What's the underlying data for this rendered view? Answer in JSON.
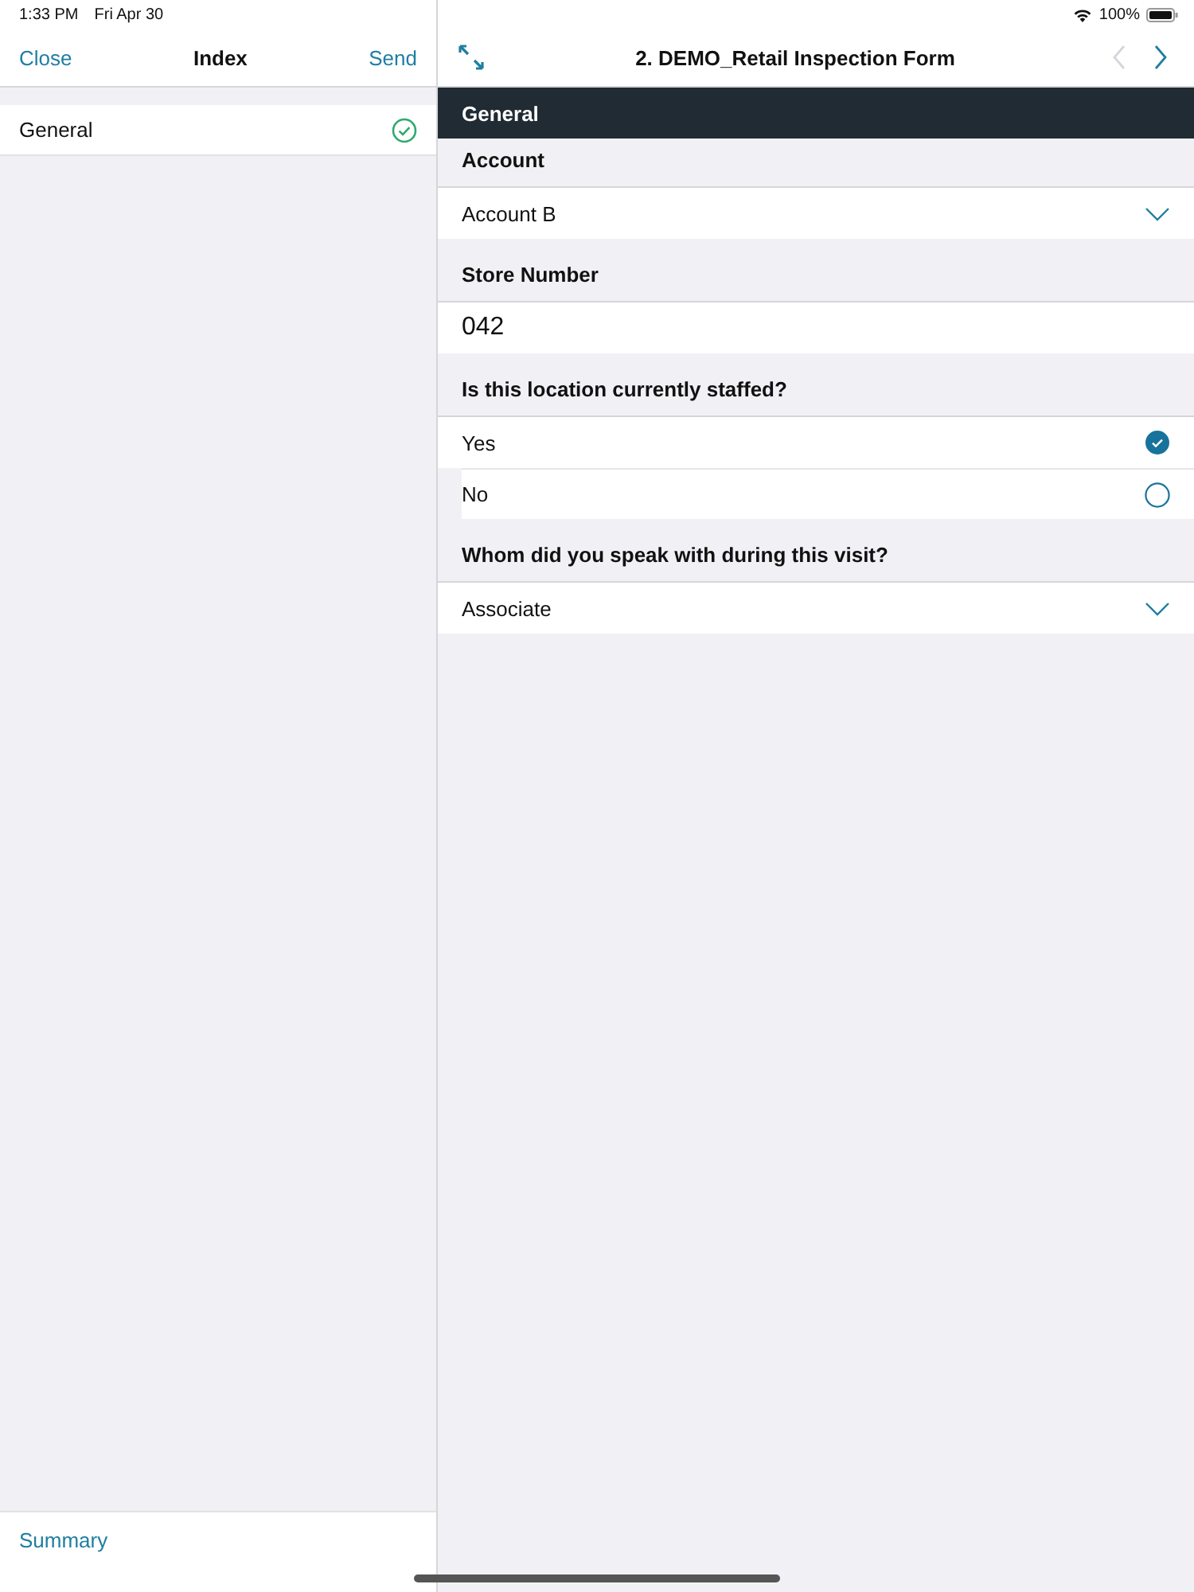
{
  "status_bar": {
    "time": "1:33 PM",
    "date": "Fri Apr 30",
    "battery": "100%"
  },
  "index_panel": {
    "close": "Close",
    "title": "Index",
    "send": "Send",
    "items": [
      {
        "label": "General",
        "complete": true
      }
    ],
    "footer": "Summary"
  },
  "form": {
    "title": "2. DEMO_Retail Inspection Form",
    "prev": {
      "disabled": true
    },
    "next": {
      "disabled": false
    },
    "section": "General",
    "questions": [
      {
        "kind": "dropdown",
        "label": "Account",
        "value": "Account B"
      },
      {
        "kind": "text",
        "label": "Store Number",
        "value": "042"
      },
      {
        "kind": "choice",
        "label": "Is this location currently staffed?",
        "options": [
          {
            "label": "Yes",
            "selected": true
          },
          {
            "label": "No",
            "selected": false
          }
        ]
      },
      {
        "kind": "dropdown",
        "label": "Whom did you speak with during this visit?",
        "value": "Associate"
      }
    ]
  }
}
